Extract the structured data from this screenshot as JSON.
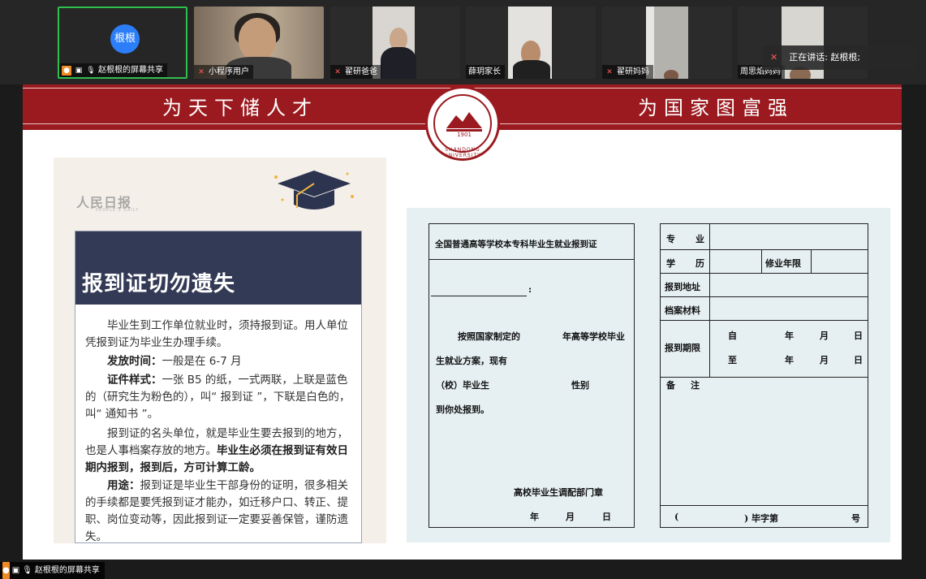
{
  "participants": [
    {
      "name": "赵根根的屏幕共享",
      "avatar_text": "根根",
      "active": true
    },
    {
      "name": "小程序用户",
      "active": false
    },
    {
      "name": "翟研爸爸",
      "active": false
    },
    {
      "name": "薛玥家长",
      "active": false
    },
    {
      "name": "翟研妈妈",
      "active": false
    },
    {
      "name": "周思焰妈妈",
      "active": false
    }
  ],
  "speaking": {
    "label": "正在讲话: 赵根根;"
  },
  "slide": {
    "motto_left": "为天下储人才",
    "motto_right": "为国家图富强",
    "seal_year": "1901",
    "seal_ring": "SHANDONG UNIVERSITY",
    "poster": {
      "logo": "人民日报",
      "logo_sub": "PEOPLE'S DAILY",
      "title": "报到证切勿遗失",
      "p1": "毕业生到工作单位就业时，须持报到证。用人单位凭报到证为毕业生办理手续。",
      "p2_label": "发放时间：",
      "p2": "一般是在 6-7 月",
      "p3_label": "证件样式：",
      "p3": "一张 B5 的纸，一式两联，上联是蓝色的（研究生为粉色的），叫“ 报到证 ”，下联是白色的，叫“ 通知书 ”。",
      "p4a": "报到证的名头单位，就是毕业生要去报到的地方，也是人事档案存放的地方。",
      "p4b": "毕业生必须在报到证有效日期内报到，报到后，方可计算工龄。",
      "p5_label": "用途：",
      "p5": "报到证是毕业生干部身份的证明，很多相关的手续都是要凭报到证才能办，如迁移户口、转正、提职、岗位变动等，因此报到证一定要妥善保管，谨防遗失。"
    },
    "form": {
      "title": "全国普通高等学校本专科毕业生就业报到证",
      "colon": ":",
      "l1a": "按照国家制定的",
      "l1b": "年高等学校毕业",
      "l2": "生就业方案，现有",
      "l3a": "（校）毕业生",
      "l3b": "性别",
      "l4": "到你处报到。",
      "dept": "高校毕业生调配部门章",
      "date_y": "年",
      "date_m": "月",
      "date_d": "日",
      "major_1": "专",
      "major_2": "业",
      "edu_1": "学",
      "edu_2": "历",
      "years": "修业年限",
      "addr": "报到地址",
      "files": "档案材料",
      "period": "报到期限",
      "from": "自",
      "to": "至",
      "y": "年",
      "m": "月",
      "d": "日",
      "note_1": "备",
      "note_2": "注",
      "no_open": "(",
      "no_mid": ") 毕字第",
      "no_end": "号"
    }
  },
  "bottom_bar": {
    "label": "赵根根的屏幕共享"
  }
}
